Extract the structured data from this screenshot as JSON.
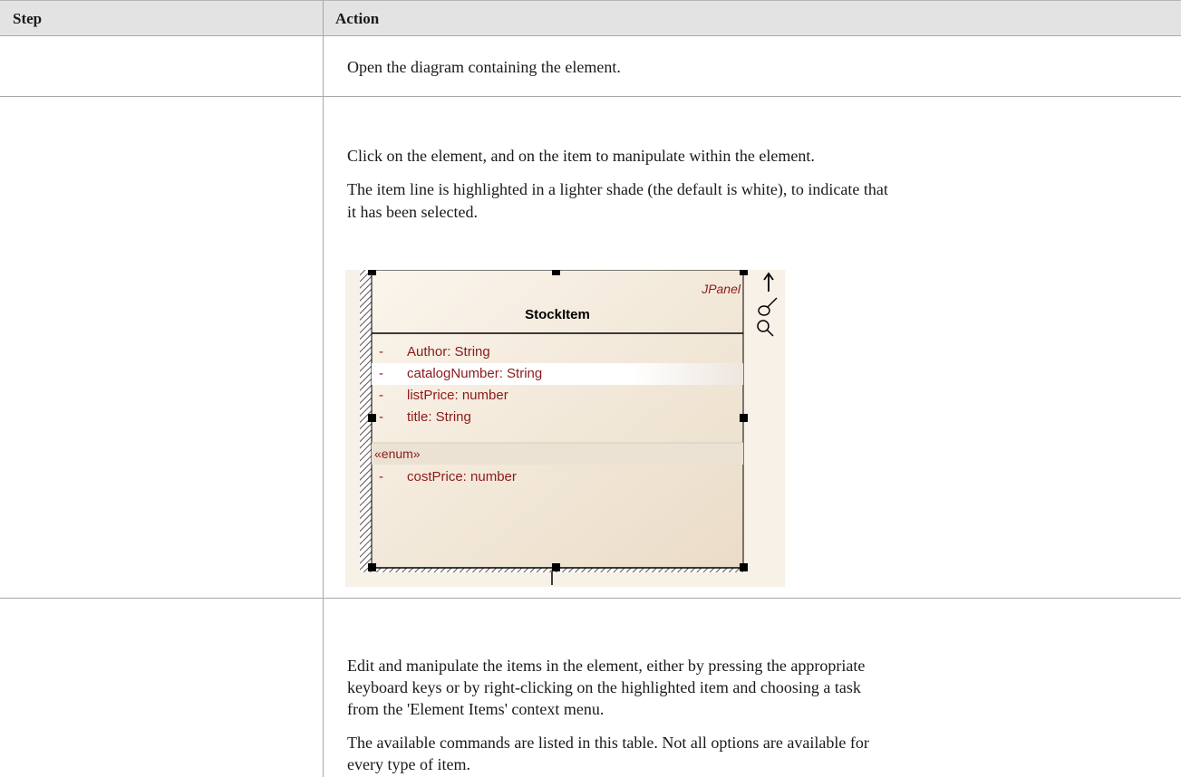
{
  "table": {
    "headers": {
      "step": "Step",
      "action": "Action"
    },
    "rows": [
      {
        "step": "",
        "paragraphs": [
          "Open the diagram containing the element."
        ]
      },
      {
        "step": "",
        "paragraphs": [
          "Click on the element, and on the item to manipulate within the element.",
          "The item line is highlighted in a lighter shade (the default is white), to indicate that",
          "it has been selected."
        ]
      },
      {
        "step": "",
        "paragraphs": [
          "Edit and manipulate the items in the element, either by pressing the appropriate",
          "keyboard keys or by right-clicking on the highlighted item and choosing a task",
          "from the 'Element Items' context menu.",
          "The available commands are listed in this table. Not all options are available for",
          "every type of item."
        ]
      }
    ]
  },
  "diagram": {
    "class_name": "StockItem",
    "stereotype": "JPanel",
    "attributes": [
      {
        "visibility": "-",
        "text": "Author: String",
        "selected": false
      },
      {
        "visibility": "-",
        "text": "catalogNumber: String",
        "selected": true
      },
      {
        "visibility": "-",
        "text": "listPrice: number",
        "selected": false
      },
      {
        "visibility": "-",
        "text": "title: String",
        "selected": false
      }
    ],
    "enum_label": "«enum»",
    "enum_attributes": [
      {
        "visibility": "-",
        "text": "costPrice: number"
      }
    ],
    "toolbar_icons": [
      "up-arrow-icon",
      "paint-brush-icon",
      "magnifier-icon"
    ],
    "colors": {
      "attribute_text": "#8b1a1a",
      "frame": "#000000",
      "fill": "#f1e6d6",
      "hatch": "#555555"
    }
  }
}
